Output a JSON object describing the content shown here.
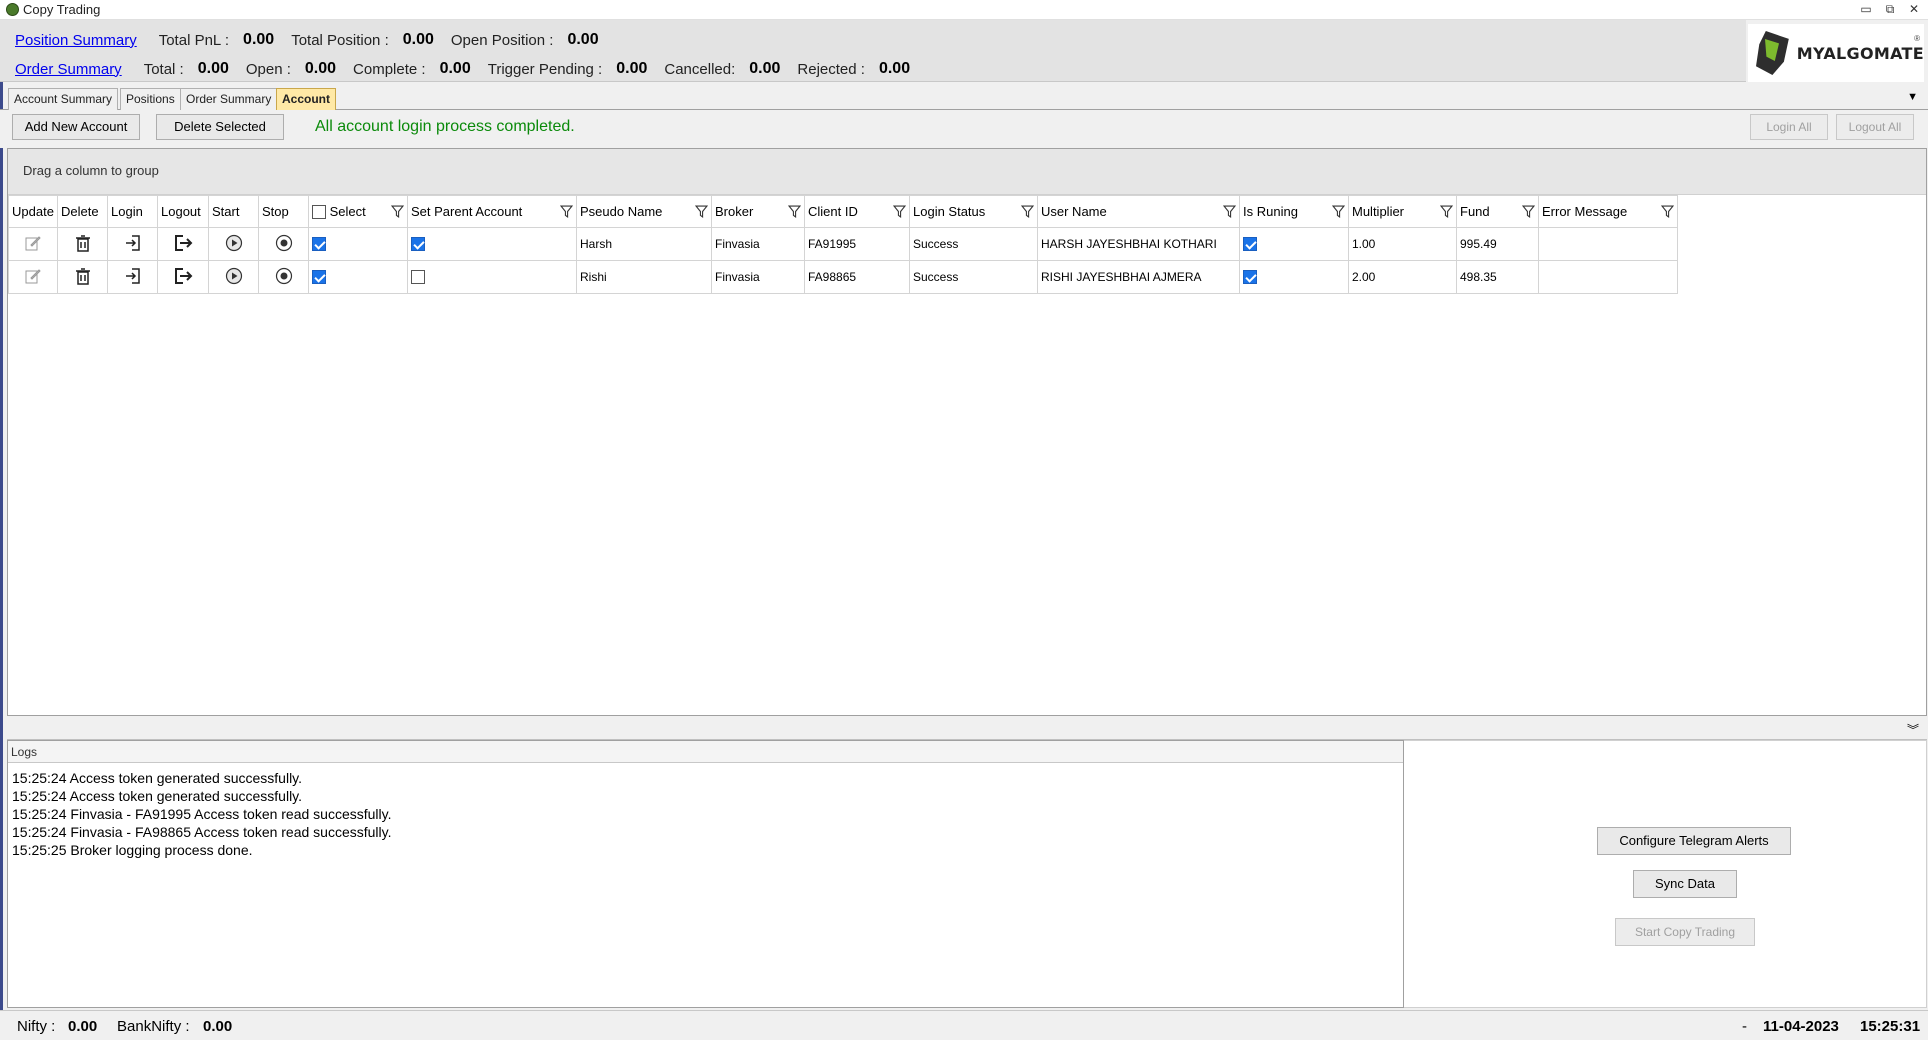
{
  "window": {
    "title": "Copy Trading",
    "minimize": "▭",
    "restore": "⧉",
    "close": "✕"
  },
  "position_summary": {
    "link": "Position Summary",
    "total_pnl_label": "Total PnL :",
    "total_pnl": "0.00",
    "total_position_label": "Total Position :",
    "total_position": "0.00",
    "open_position_label": "Open Position :",
    "open_position": "0.00"
  },
  "order_summary": {
    "link": "Order Summary",
    "total_label": "Total :",
    "total": "0.00",
    "open_label": "Open :",
    "open": "0.00",
    "complete_label": "Complete :",
    "complete": "0.00",
    "trigger_pending_label": "Trigger Pending :",
    "trigger_pending": "0.00",
    "cancelled_label": "Cancelled:",
    "cancelled": "0.00",
    "rejected_label": "Rejected :",
    "rejected": "0.00"
  },
  "logo": {
    "text": "MYALGOMATE",
    "reg": "®"
  },
  "tabs": [
    "Account Summary",
    "Positions",
    "Order Summary",
    "Account"
  ],
  "active_tab": "Account",
  "toolbar": {
    "add_account": "Add  New Account",
    "delete_selected": "Delete Selected",
    "status_message": "All account login process completed.",
    "login_all": "Login All",
    "logout_all": "Logout All"
  },
  "grid": {
    "group_hint": "Drag a column to group",
    "columns": {
      "update": "Update",
      "delete": "Delete",
      "login": "Login",
      "logout": "Logout",
      "start": "Start",
      "stop": "Stop",
      "select": "Select",
      "set_parent": "Set Parent Account",
      "pseudo_name": "Pseudo Name",
      "broker": "Broker",
      "client_id": "Client ID",
      "login_status": "Login Status",
      "user_name": "User Name",
      "is_running": "Is Runing",
      "multiplier": "Multiplier",
      "fund": "Fund",
      "error_message": "Error Message"
    },
    "rows": [
      {
        "select": true,
        "parent": true,
        "pseudo_name": "Harsh",
        "broker": "Finvasia",
        "client_id": "FA91995",
        "login_status": "Success",
        "user_name": "HARSH JAYESHBHAI KOTHARI",
        "is_running": true,
        "multiplier": "1.00",
        "fund": "995.49",
        "error": ""
      },
      {
        "select": true,
        "parent": false,
        "pseudo_name": "Rishi",
        "broker": "Finvasia",
        "client_id": "FA98865",
        "login_status": "Success",
        "user_name": "RISHI JAYESHBHAI AJMERA",
        "is_running": true,
        "multiplier": "2.00",
        "fund": "498.35",
        "error": ""
      }
    ]
  },
  "logs": {
    "header": "Logs",
    "lines": [
      "15:25:24 Access token generated successfully.",
      "15:25:24 Access token generated successfully.",
      "15:25:24 Finvasia - FA91995 Access token read successfully.",
      "15:25:24 Finvasia - FA98865 Access token read successfully.",
      "15:25:25 Broker logging process done."
    ]
  },
  "side_buttons": {
    "telegram": "Configure Telegram Alerts",
    "sync": "Sync Data",
    "start_copy": "Start Copy Trading"
  },
  "footer": {
    "nifty_label": "Nifty :",
    "nifty": "0.00",
    "banknifty_label": "BankNifty :",
    "banknifty": "0.00",
    "separator": "-",
    "date": "11-04-2023",
    "time": "15:25:31"
  },
  "colors": {
    "accent_link": "#0000ee",
    "status_green": "#0a8a0a",
    "active_tab": "#ffe9a6",
    "checkbox": "#1a73e8"
  }
}
